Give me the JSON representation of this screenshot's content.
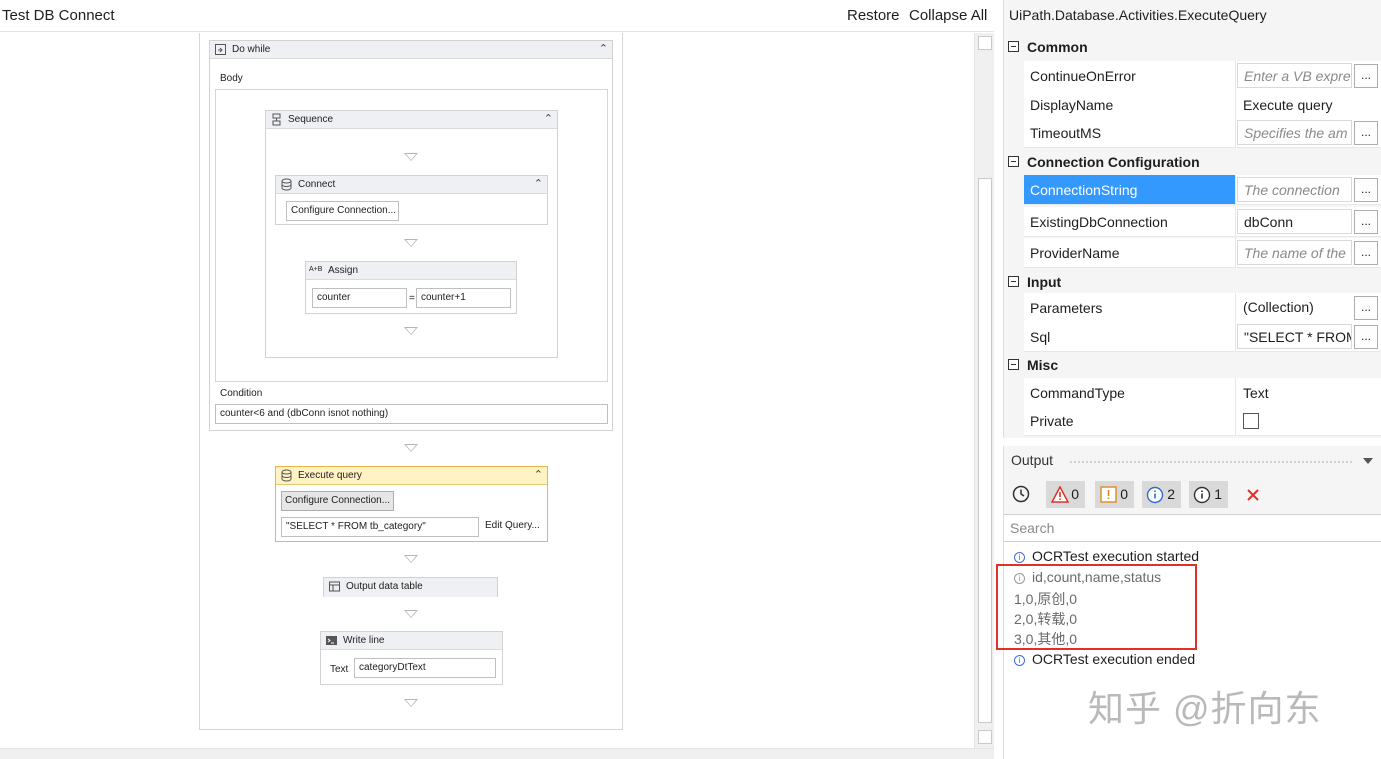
{
  "designer": {
    "title": "Test DB Connect",
    "restore": "Restore",
    "collapse_all": "Collapse All",
    "do_while": {
      "title": "Do while",
      "body_label": "Body",
      "condition_label": "Condition",
      "condition_value": "counter<6 and (dbConn isnot nothing)"
    },
    "sequence": {
      "title": "Sequence"
    },
    "connect": {
      "title": "Connect",
      "button": "Configure Connection..."
    },
    "assign": {
      "title": "Assign",
      "icon_text": "A+B",
      "left": "counter",
      "equals": "=",
      "right": "counter+1"
    },
    "execute_query": {
      "title": "Execute query",
      "button": "Configure Connection...",
      "sql": "\"SELECT * FROM tb_category\"",
      "edit": "Edit Query..."
    },
    "output_table": {
      "title": "Output data table"
    },
    "write_line": {
      "title": "Write line",
      "text_label": "Text",
      "text_value": "categoryDtText"
    }
  },
  "properties": {
    "title": "UiPath.Database.Activities.ExecuteQuery",
    "categories": {
      "common": "Common",
      "connection": "Connection Configuration",
      "input": "Input",
      "misc": "Misc"
    },
    "rows": {
      "continue_on_error": {
        "name": "ContinueOnError",
        "value": "Enter a VB expre"
      },
      "display_name": {
        "name": "DisplayName",
        "value": "Execute query"
      },
      "timeout": {
        "name": "TimeoutMS",
        "value": "Specifies the am"
      },
      "connection_string": {
        "name": "ConnectionString",
        "value": "The connection"
      },
      "existing_db": {
        "name": "ExistingDbConnection",
        "value": "dbConn"
      },
      "provider": {
        "name": "ProviderName",
        "value": "The name of the"
      },
      "parameters": {
        "name": "Parameters",
        "value": "(Collection)"
      },
      "sql": {
        "name": "Sql",
        "value": "\"SELECT * FROM"
      },
      "command_type": {
        "name": "CommandType",
        "value": "Text"
      },
      "private": {
        "name": "Private",
        "checked": false
      }
    },
    "ellipsis": "..."
  },
  "output": {
    "title": "Output",
    "counts": {
      "errors": "0",
      "warnings": "0",
      "info": "2",
      "trace": "1"
    },
    "search_placeholder": "Search",
    "lines": [
      "OCRTest execution started",
      "id,count,name,status",
      "1,0,原创,0",
      "2,0,转载,0",
      "3,0,其他,0",
      "OCRTest execution ended"
    ],
    "info_glyph": "i"
  },
  "watermark": "知乎 @折向东",
  "colors": {
    "selection": "#3399ff",
    "highlight_activity": "#fff3c4",
    "annotation_box": "#e0302a"
  }
}
